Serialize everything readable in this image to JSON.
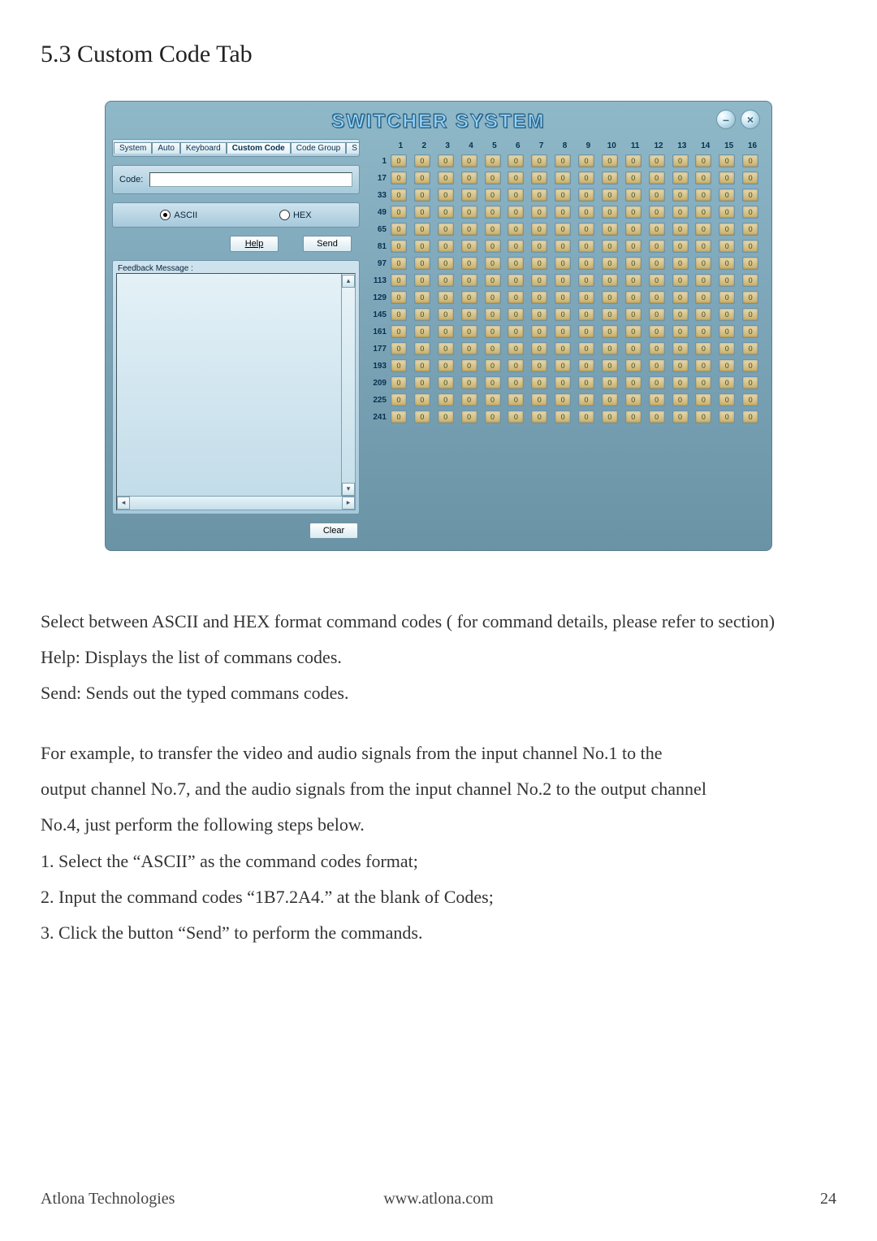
{
  "doc": {
    "section_title": "5.3 Custom Code Tab",
    "para1": "Select between ASCII and HEX format command codes ( for command  details, please refer to section)",
    "para2": "Help: Displays the list of commans codes.",
    "para3": "Send: Sends out the typed commans codes.",
    "para4": "For example, to transfer the video and audio signals from the input channel No.1 to the",
    "para5": "output channel No.7, and the audio signals from the input channel No.2 to the output channel",
    "para6": "No.4, just perform the following steps below.",
    "step1": "1. Select the “ASCII” as the command codes format;",
    "step2": "2. Input the command codes “1B7.2A4.” at the blank of Codes;",
    "step3": "3. Click the button “Send” to perform the commands.",
    "footer_left": "Atlona Technologies",
    "footer_center": "www.atlona.com",
    "footer_right": "24"
  },
  "app": {
    "title": "SWITCHER SYSTEM",
    "minimize_glyph": "–",
    "close_glyph": "×",
    "tabs": {
      "system": "System",
      "auto": "Auto",
      "keyboard": "Keyboard",
      "custom_code": "Custom Code",
      "code_group": "Code Group",
      "extra": "S",
      "arrow_left": "◂",
      "arrow_right": "▸"
    },
    "code_label": "Code:",
    "code_value": "",
    "radio_ascii": "ASCII",
    "radio_hex": "HEX",
    "radio_selected": "ASCII",
    "help_btn": "Help",
    "send_btn": "Send",
    "feedback_label": "Feedback Message :",
    "clear_btn": "Clear",
    "scroll_up": "▴",
    "scroll_down": "▾",
    "scroll_left": "◂",
    "scroll_right": "▸",
    "grid": {
      "col_headers": [
        "1",
        "2",
        "3",
        "4",
        "5",
        "6",
        "7",
        "8",
        "9",
        "10",
        "11",
        "12",
        "13",
        "14",
        "15",
        "16"
      ],
      "row_headers": [
        "1",
        "17",
        "33",
        "49",
        "65",
        "81",
        "97",
        "113",
        "129",
        "145",
        "161",
        "177",
        "193",
        "209",
        "225",
        "241"
      ],
      "cell_value": "0"
    }
  }
}
